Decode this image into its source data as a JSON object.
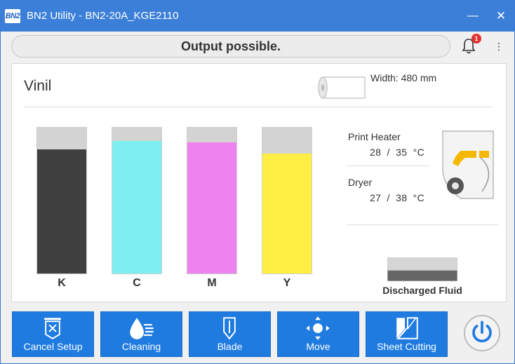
{
  "window": {
    "app_icon_text": "BN2",
    "title": "BN2 Utility - BN2-20A_KGE2110",
    "minimize_glyph": "—",
    "close_glyph": "✕"
  },
  "status": {
    "message": "Output possible.",
    "notification_count": "1",
    "menu_glyph": "⋮"
  },
  "media": {
    "name": "Vinil",
    "width_text": "Width: 480 mm"
  },
  "inks": [
    {
      "label": "K",
      "color": "#404040",
      "level": 0.85
    },
    {
      "label": "C",
      "color": "#7eeef0",
      "level": 0.91
    },
    {
      "label": "M",
      "color": "#ee82ee",
      "level": 0.9
    },
    {
      "label": "Y",
      "color": "#ffee44",
      "level": 0.82
    }
  ],
  "heaters": {
    "print_heater": {
      "label": "Print Heater",
      "value": "28  /  35  °C"
    },
    "dryer": {
      "label": "Dryer",
      "value": "27  /  38  °C"
    }
  },
  "discharged_fluid": {
    "label": "Discharged Fluid",
    "level": 0.45
  },
  "toolbar": [
    {
      "label": "Cancel Setup",
      "icon": "cancel-setup-icon"
    },
    {
      "label": "Cleaning",
      "icon": "cleaning-icon"
    },
    {
      "label": "Blade",
      "icon": "blade-icon"
    },
    {
      "label": "Move",
      "icon": "move-icon"
    },
    {
      "label": "Sheet Cutting",
      "icon": "sheet-cutting-icon"
    }
  ],
  "colors": {
    "titlebar": "#3c7fd8",
    "button": "#1f7be0",
    "power_icon": "#1f7be0",
    "heater_accent": "#f5b800",
    "badge": "#e03030"
  }
}
